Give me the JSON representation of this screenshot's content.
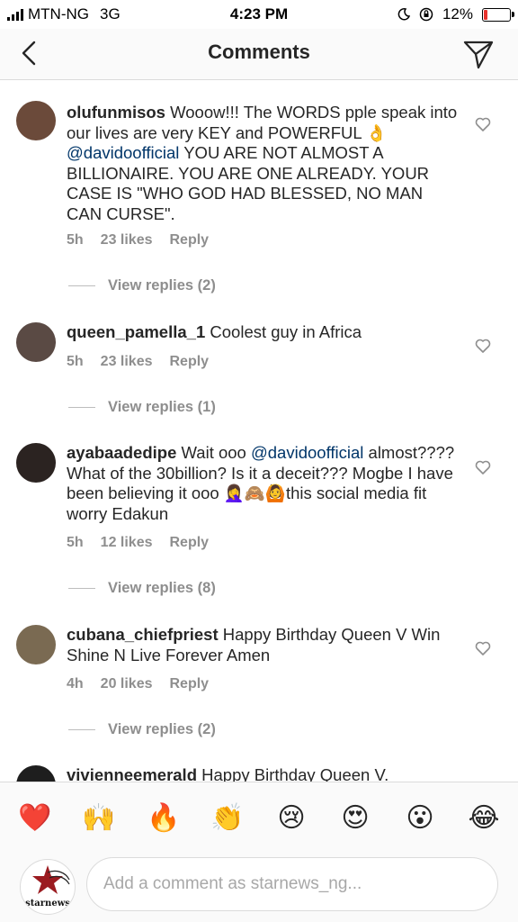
{
  "status_bar": {
    "carrier": "MTN-NG",
    "network": "3G",
    "time": "4:23 PM",
    "battery": "12%",
    "battery_level": 0.12
  },
  "header": {
    "title": "Comments",
    "back_icon": "chevron-left-icon",
    "send_icon": "send-icon"
  },
  "comments": [
    {
      "username": "olufunmisos",
      "text_parts": [
        {
          "text": "Wooow!!! The WORDS pple speak into our lives are very KEY and POWERFUL 👌 "
        },
        {
          "text": "@davidoofficial",
          "mention": true
        },
        {
          "text": " YOU ARE NOT ALMOST A BILLIONAIRE.  YOU ARE ONE ALREADY. YOUR CASE IS \"WHO GOD HAD BLESSED, NO MAN CAN CURSE\"."
        }
      ],
      "time": "5h",
      "likes": "23 likes",
      "reply": "Reply",
      "view_replies": "View replies (2)",
      "avatar_color": "#6b4a3a"
    },
    {
      "username": "queen_pamella_1",
      "text_parts": [
        {
          "text": "Coolest guy in Africa"
        }
      ],
      "time": "5h",
      "likes": "23 likes",
      "reply": "Reply",
      "view_replies": "View replies (1)",
      "avatar_color": "#5a4a44"
    },
    {
      "username": "ayabaadedipe",
      "text_parts": [
        {
          "text": "Wait ooo "
        },
        {
          "text": "@davidoofficial",
          "mention": true
        },
        {
          "text": " almost???? What of the 30billion? Is it a deceit??? Mogbe I have been believing it ooo 🤦‍♀️🙈🙆this social media fit worry Edakun"
        }
      ],
      "time": "5h",
      "likes": "12 likes",
      "reply": "Reply",
      "view_replies": "View replies (8)",
      "avatar_color": "#2b2321"
    },
    {
      "username": "cubana_chiefpriest",
      "text_parts": [
        {
          "text": "Happy Birthday Queen V Win Shine N Live Forever Amen"
        }
      ],
      "time": "4h",
      "likes": "20 likes",
      "reply": "Reply",
      "view_replies": "View replies (2)",
      "avatar_color": "#7a6a52"
    },
    {
      "username": "vivienneemerald",
      "text_parts": [
        {
          "text": "Happy Birthday Queen V."
        }
      ],
      "avatar_color": "#1e1e1e"
    }
  ],
  "emoji_bar": [
    "❤️",
    "🙌",
    "🔥",
    "👏",
    "😢",
    "😍",
    "😮",
    "😂"
  ],
  "composer": {
    "placeholder": "Add a comment as starnews_ng...",
    "profile_brand": "starnews"
  },
  "colors": {
    "mention": "#003569",
    "meta": "#8e8e8e",
    "text": "#262626",
    "battery_low": "#e8332e"
  }
}
